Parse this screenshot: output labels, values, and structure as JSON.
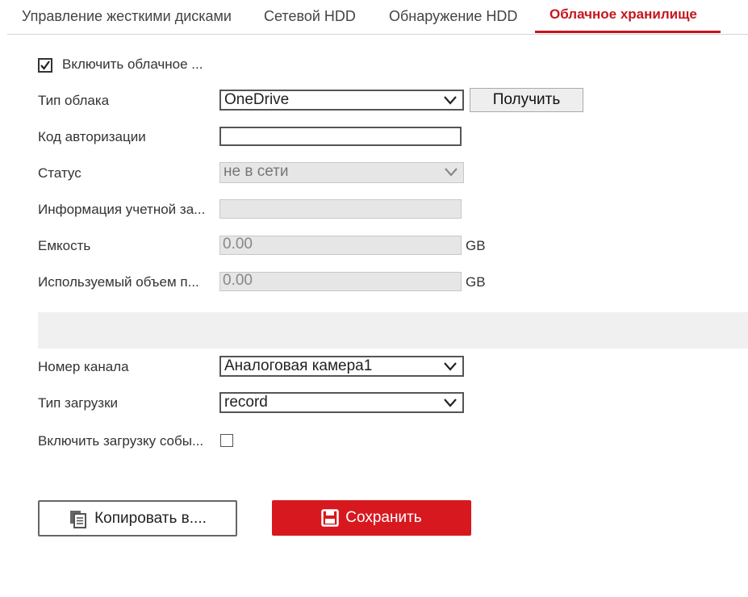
{
  "tabs": [
    {
      "label": "Управление жесткими дисками"
    },
    {
      "label": "Сетевой HDD"
    },
    {
      "label": "Обнаружение HDD"
    },
    {
      "label": "Облачное хранилище"
    }
  ],
  "active_tab": "Облачное хранилище",
  "enable_cloud": {
    "label": "Включить облачное ...",
    "checked": true
  },
  "cloud_type": {
    "label": "Тип облака",
    "value": "OneDrive",
    "get_button": "Получить"
  },
  "auth_code": {
    "label": "Код авторизации",
    "value": ""
  },
  "status": {
    "label": "Статус",
    "value": "не в сети"
  },
  "account_info": {
    "label": "Информация учетной за...",
    "value": ""
  },
  "capacity": {
    "label": "Емкость",
    "value": "0.00",
    "unit": "GB"
  },
  "used": {
    "label": "Используемый объем п...",
    "value": "0.00",
    "unit": "GB"
  },
  "channel": {
    "label": "Номер канала",
    "value": "Аналоговая камера1"
  },
  "upload_type": {
    "label": "Тип загрузки",
    "value": "record"
  },
  "event_upload": {
    "label": "Включить загрузку собы...",
    "checked": false
  },
  "buttons": {
    "copy": "Копировать в....",
    "save": "Сохранить"
  },
  "colors": {
    "accent": "#c5161d",
    "save_bg": "#d7191f"
  }
}
